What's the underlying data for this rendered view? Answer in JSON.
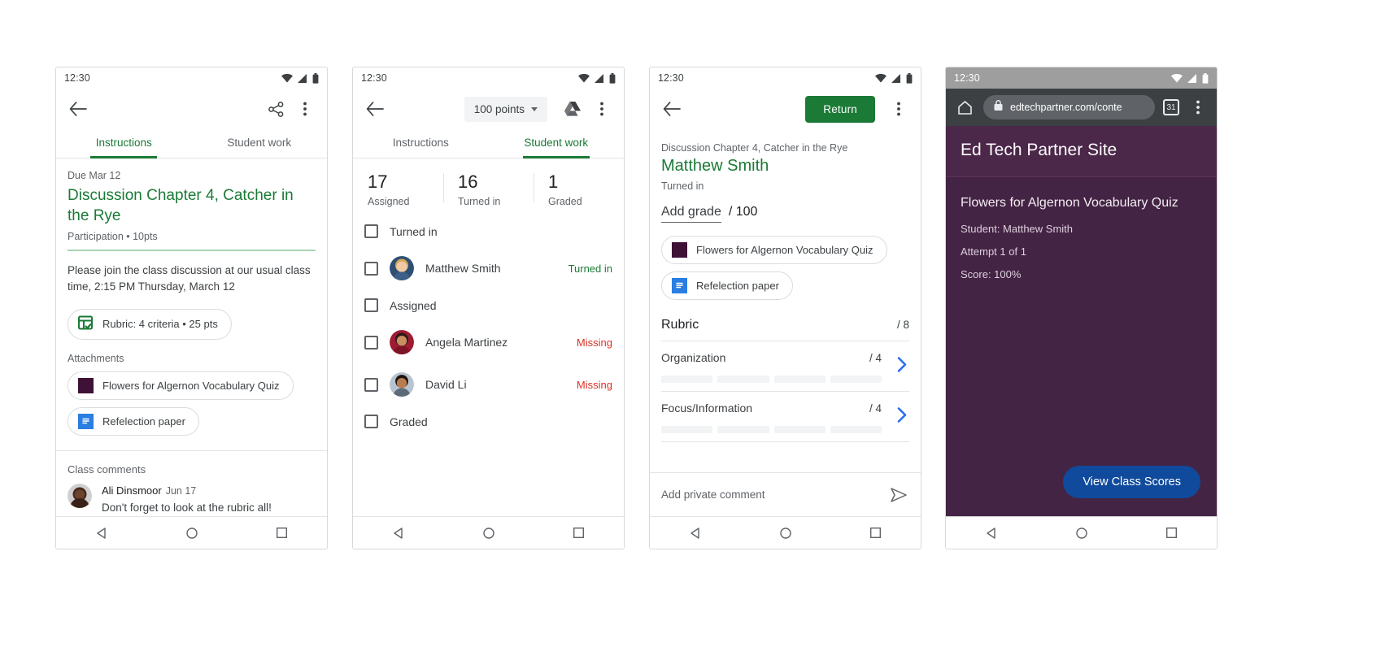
{
  "status_bar": {
    "time": "12:30"
  },
  "phone1": {
    "appbar": {
      "back": "back-arrow",
      "share": "share",
      "more": "more-options"
    },
    "tabs": [
      {
        "label": "Instructions",
        "active": true
      },
      {
        "label": "Student work",
        "active": false
      }
    ],
    "due": "Due Mar 12",
    "title": "Discussion Chapter 4, Catcher in the Rye",
    "subline": "Participation • 10pts",
    "description": "Please join the class discussion at our usual class time, 2:15 PM Thursday, March 12",
    "rubric_chip": "Rubric: 4 criteria • 25 pts",
    "attachments_label": "Attachments",
    "attachments": [
      {
        "label": "Flowers for Algernon Vocabulary Quiz",
        "icon": "purple-swatch"
      },
      {
        "label": "Refelection paper",
        "icon": "doc-icon"
      }
    ],
    "comments_title": "Class comments",
    "comments": [
      {
        "name": "Ali Dinsmoor",
        "date": "Jun 17",
        "text": "Don't forget to look at the rubric all!"
      }
    ]
  },
  "phone2": {
    "appbar": {
      "points": "100 points",
      "drive": "drive-icon",
      "more": "more-options"
    },
    "tabs": [
      {
        "label": "Instructions",
        "active": false
      },
      {
        "label": "Student work",
        "active": true
      }
    ],
    "stats": [
      {
        "num": "17",
        "cap": "Assigned"
      },
      {
        "num": "16",
        "cap": "Turned in"
      },
      {
        "num": "1",
        "cap": "Graded"
      }
    ],
    "groups": [
      {
        "label": "Turned in",
        "students": [
          {
            "name": "Matthew Smith",
            "status": "Turned in",
            "status_kind": "turned"
          }
        ]
      },
      {
        "label": "Assigned",
        "students": [
          {
            "name": "Angela Martinez",
            "status": "Missing",
            "status_kind": "missing"
          },
          {
            "name": "David Li",
            "status": "Missing",
            "status_kind": "missing"
          }
        ]
      },
      {
        "label": "Graded",
        "students": []
      }
    ]
  },
  "phone3": {
    "appbar": {
      "return_label": "Return",
      "more": "more-options"
    },
    "assignment": "Discussion Chapter 4, Catcher in the Rye",
    "student": "Matthew Smith",
    "state": "Turned in",
    "grade_placeholder": "Add grade",
    "grade_max": "/ 100",
    "attachments": [
      {
        "label": "Flowers for Algernon Vocabulary Quiz",
        "icon": "purple-swatch"
      },
      {
        "label": "Refelection paper",
        "icon": "doc-icon"
      }
    ],
    "rubric": {
      "title": "Rubric",
      "total": "/ 8",
      "criteria": [
        {
          "name": "Organization",
          "points": "/ 4",
          "levels": 4
        },
        {
          "name": "Focus/Information",
          "points": "/ 4",
          "levels": 4
        }
      ]
    },
    "comment_placeholder": "Add private comment"
  },
  "phone4": {
    "browser": {
      "home": "home-icon",
      "lock": "lock-icon",
      "url": "edtechpartner.com/conte",
      "tabs": "31",
      "more": "more-options"
    },
    "site_title": "Ed Tech Partner Site",
    "quiz_title": "Flowers for Algernon Vocabulary Quiz",
    "lines": [
      "Student: Matthew Smith",
      "Attempt 1 of 1",
      "Score: 100%"
    ],
    "cta": "View Class Scores"
  },
  "colors": {
    "green": "#1a7a36",
    "red": "#d93025",
    "blue": "#104a9c",
    "purple": "#442444",
    "chevron_blue": "#2a6ff0"
  }
}
